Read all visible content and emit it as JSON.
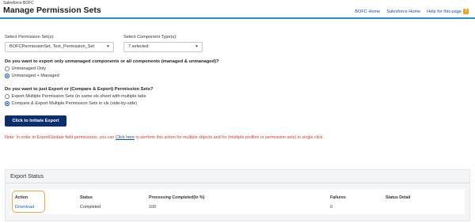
{
  "header": {
    "app_label": "Salesforce BOFC",
    "title": "Manage Permission Sets",
    "links": {
      "bofc_home": "BOFC Home",
      "salesforce_home": "Salesforce Home",
      "help": "Help for this page",
      "help_icon": "?"
    }
  },
  "selects": {
    "permission_set": {
      "label": "Select Permission Set(s):",
      "value": "BOFCPermissionSet, Test_Permission_Set"
    },
    "component_type": {
      "label": "Select Component Type(s):",
      "value": "7 selected"
    }
  },
  "q1": {
    "text": "Do you want to export only unmanaged components or all components (managed & unmanaged)?",
    "options": [
      "Unmanaged Only",
      "Unmanaged + Managed"
    ],
    "selected": 1
  },
  "q2": {
    "text": "Do you want to just Export or (Compare & Export) Permission Sets?",
    "options": [
      "Export Multiple Permission Sets (in same xls sheet with multiple tabs",
      "Compare & Export Multiple Permission Sets in xls (side-by-side)"
    ],
    "selected": 1
  },
  "export_button": "Click to Initiate Export",
  "note": {
    "before": "Note: In order to Export/Update field permissions, you can ",
    "link": "Click here",
    "after": " to perform this action for multiple objects and for (multiple profiles or permission sets) in single click."
  },
  "status": {
    "title": "Export Status",
    "columns": [
      "Action",
      "Status",
      "Processing Completed(In %)",
      "Failures",
      "Status Detail"
    ],
    "row": {
      "action": "Download",
      "status": "Completed",
      "processing": "100",
      "failures": "0",
      "detail": ""
    }
  },
  "colors": {
    "primary_button": "#0b2f6e",
    "header_rule": "#2a8fd0",
    "note_text": "#d43a2a",
    "highlight": "#f3a540"
  }
}
